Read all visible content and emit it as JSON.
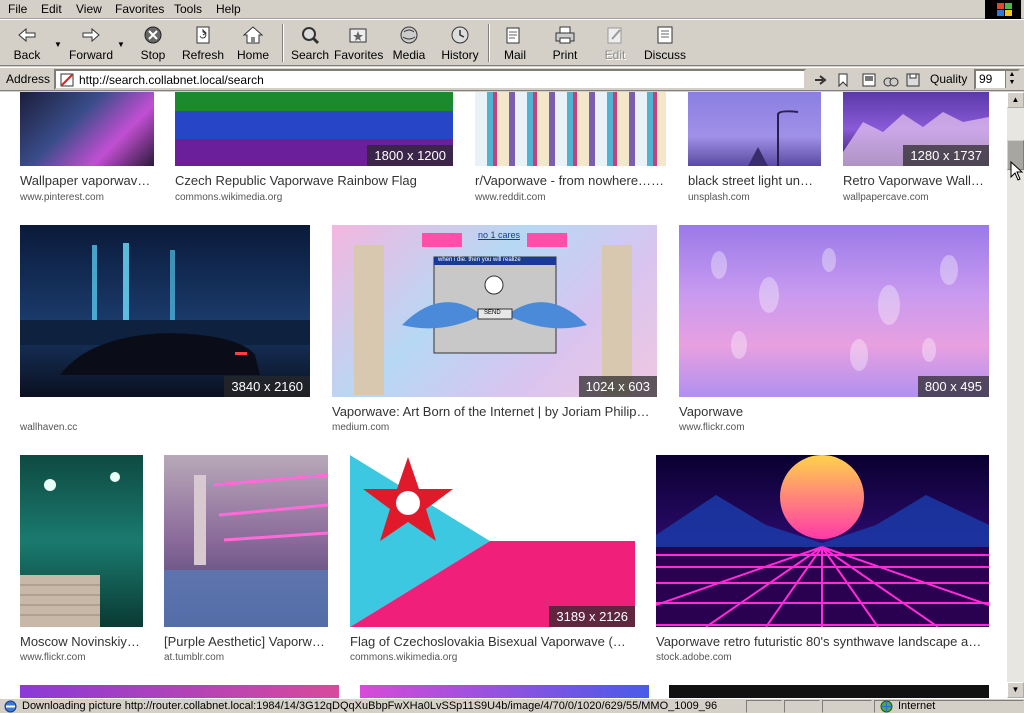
{
  "menu": [
    "File",
    "Edit",
    "View",
    "Favorites",
    "Tools",
    "Help"
  ],
  "toolbar": {
    "back": "Back",
    "forward": "Forward",
    "stop": "Stop",
    "refresh": "Refresh",
    "home": "Home",
    "search": "Search",
    "favorites": "Favorites",
    "media": "Media",
    "history": "History",
    "mail": "Mail",
    "print": "Print",
    "edit": "Edit",
    "discuss": "Discuss"
  },
  "address": {
    "label": "Address",
    "url": "http://search.collabnet.local/search"
  },
  "quality": {
    "label": "Quality",
    "value": "99"
  },
  "results": [
    {
      "title": "Wallpaper vaporwave…",
      "source": "www.pinterest.com",
      "dims": ""
    },
    {
      "title": "Czech Republic Vaporwave Rainbow Flag",
      "source": "commons.wikimedia.org",
      "dims": "1800 x 1200"
    },
    {
      "title": "r/Vaporwave - from nowhere…, …",
      "source": "www.reddit.com",
      "dims": ""
    },
    {
      "title": "black street light un…",
      "source": "unsplash.com",
      "dims": ""
    },
    {
      "title": "Retro Vaporwave Wall…",
      "source": "wallpapercave.com",
      "dims": "1280 x 1737"
    },
    {
      "title": "",
      "source": "wallhaven.cc",
      "dims": "3840 x 2160"
    },
    {
      "title": "Vaporwave: Art Born of the Internet | by Joriam Philip…",
      "source": "medium.com",
      "dims": "1024 x 603"
    },
    {
      "title": "Vaporwave",
      "source": "www.flickr.com",
      "dims": "800 x 495"
    },
    {
      "title": "Moscow Novinskiy…",
      "source": "www.flickr.com",
      "dims": ""
    },
    {
      "title": "[Purple Aesthetic] Vaporw…",
      "source": "at.tumblr.com",
      "dims": ""
    },
    {
      "title": "Flag of Czechoslovakia Bisexual Vaporwave (…",
      "source": "commons.wikimedia.org",
      "dims": "3189 x 2126"
    },
    {
      "title": "Vaporwave retro futuristic 80's synthwave landscape a…",
      "source": "stock.adobe.com",
      "dims": ""
    }
  ],
  "thumb_text": {
    "meme_header": "no 1 cares",
    "meme_dialog": "when i die. then you will realize",
    "meme_button": "SEND"
  },
  "status": {
    "text": "Downloading picture http://router.collabnet.local:1984/14/3G12qDQqXuBbpFwXHa0LvSSp11S9U4b/image/4/70/0/1020/629/55/MMO_1009_96",
    "zone": "Internet"
  },
  "icons": [
    "back-icon",
    "forward-icon",
    "stop-icon",
    "refresh-icon",
    "home-icon",
    "search-icon",
    "favorites-icon",
    "media-icon",
    "history-icon",
    "mail-icon",
    "print-icon",
    "edit-icon",
    "discuss-icon",
    "page-icon",
    "go-icon",
    "ie-icon"
  ],
  "colors": {
    "chrome": "#d4d0c8",
    "page": "#ffffff",
    "label_overlay": "#2a2a2a"
  }
}
